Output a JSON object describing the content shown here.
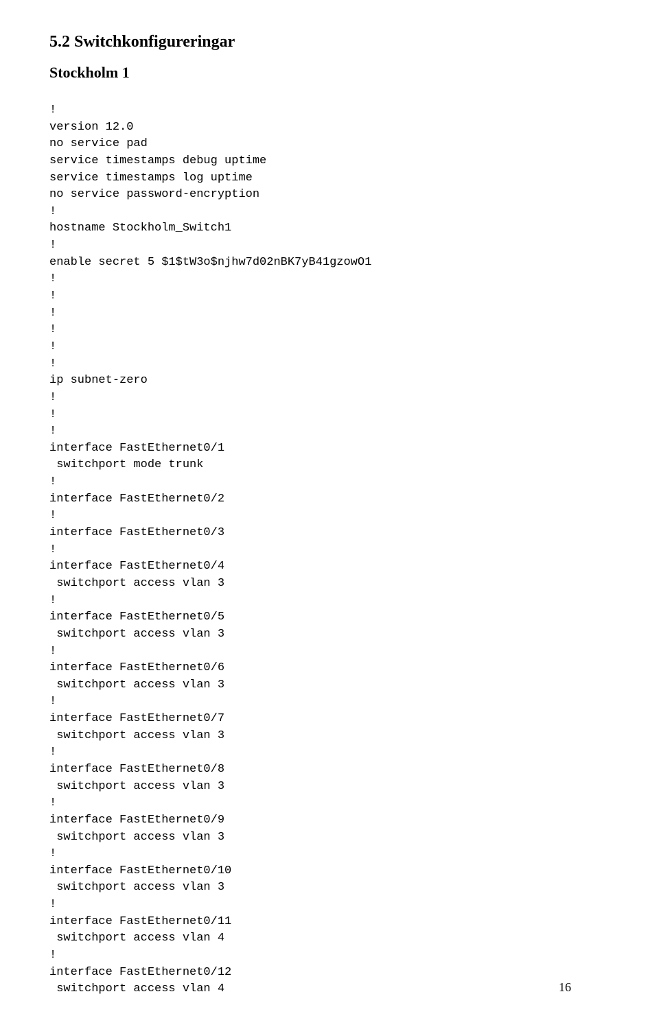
{
  "heading": "5.2 Switchkonfigureringar",
  "subheading": "Stockholm 1",
  "code": "!\nversion 12.0\nno service pad\nservice timestamps debug uptime\nservice timestamps log uptime\nno service password-encryption\n!\nhostname Stockholm_Switch1\n!\nenable secret 5 $1$tW3o$njhw7d02nBK7yB41gzowO1\n!\n!\n!\n!\n!\n!\nip subnet-zero\n!\n!\n!\ninterface FastEthernet0/1\n switchport mode trunk\n!\ninterface FastEthernet0/2\n!\ninterface FastEthernet0/3\n!\ninterface FastEthernet0/4\n switchport access vlan 3\n!\ninterface FastEthernet0/5\n switchport access vlan 3\n!\ninterface FastEthernet0/6\n switchport access vlan 3\n!\ninterface FastEthernet0/7\n switchport access vlan 3\n!\ninterface FastEthernet0/8\n switchport access vlan 3\n!\ninterface FastEthernet0/9\n switchport access vlan 3\n!\ninterface FastEthernet0/10\n switchport access vlan 3\n!\ninterface FastEthernet0/11\n switchport access vlan 4\n!\ninterface FastEthernet0/12\n switchport access vlan 4",
  "page_number": "16"
}
